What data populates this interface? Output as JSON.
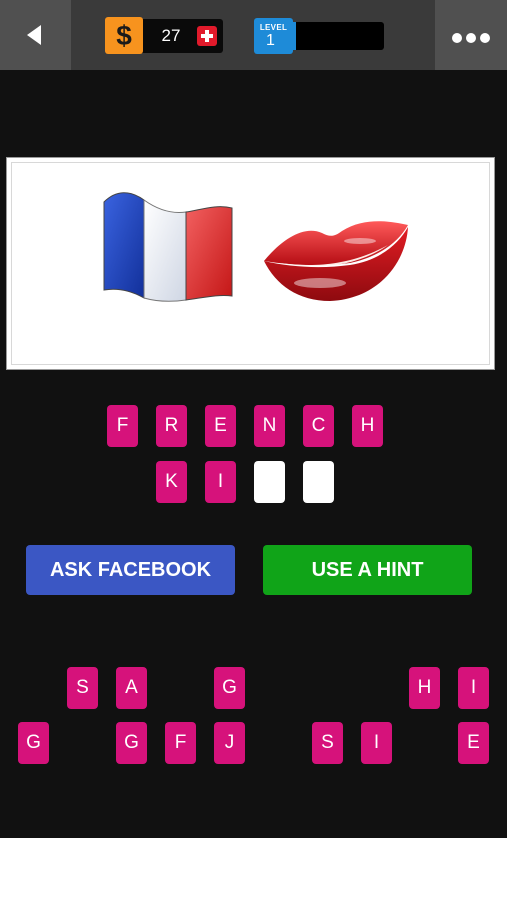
{
  "header": {
    "coin_symbol": "$",
    "coins": "27",
    "level_label": "LEVEL",
    "level_number": "1",
    "level_progress": 0.03,
    "icons": {
      "back": "back-arrow-icon",
      "menu": "more-dots-icon",
      "add_coins": "plus-icon"
    }
  },
  "puzzle": {
    "emojis": [
      "french-flag",
      "red-lips"
    ]
  },
  "answer": {
    "row1": [
      "F",
      "R",
      "E",
      "N",
      "C",
      "H"
    ],
    "row2": [
      "K",
      "I",
      "",
      ""
    ]
  },
  "buttons": {
    "ask_facebook": "ASK FACEBOOK",
    "use_hint": "USE A HINT"
  },
  "letter_bank": {
    "row1": [
      "S",
      "A",
      "G",
      "H",
      "I"
    ],
    "row2": [
      "G",
      "G",
      "F",
      "J",
      "S",
      "I",
      "E"
    ]
  },
  "colors": {
    "tile": "#d6127b",
    "facebook": "#3b57c4",
    "hint": "#10a418",
    "coin": "#f7931e",
    "level": "#1e8bd8"
  }
}
